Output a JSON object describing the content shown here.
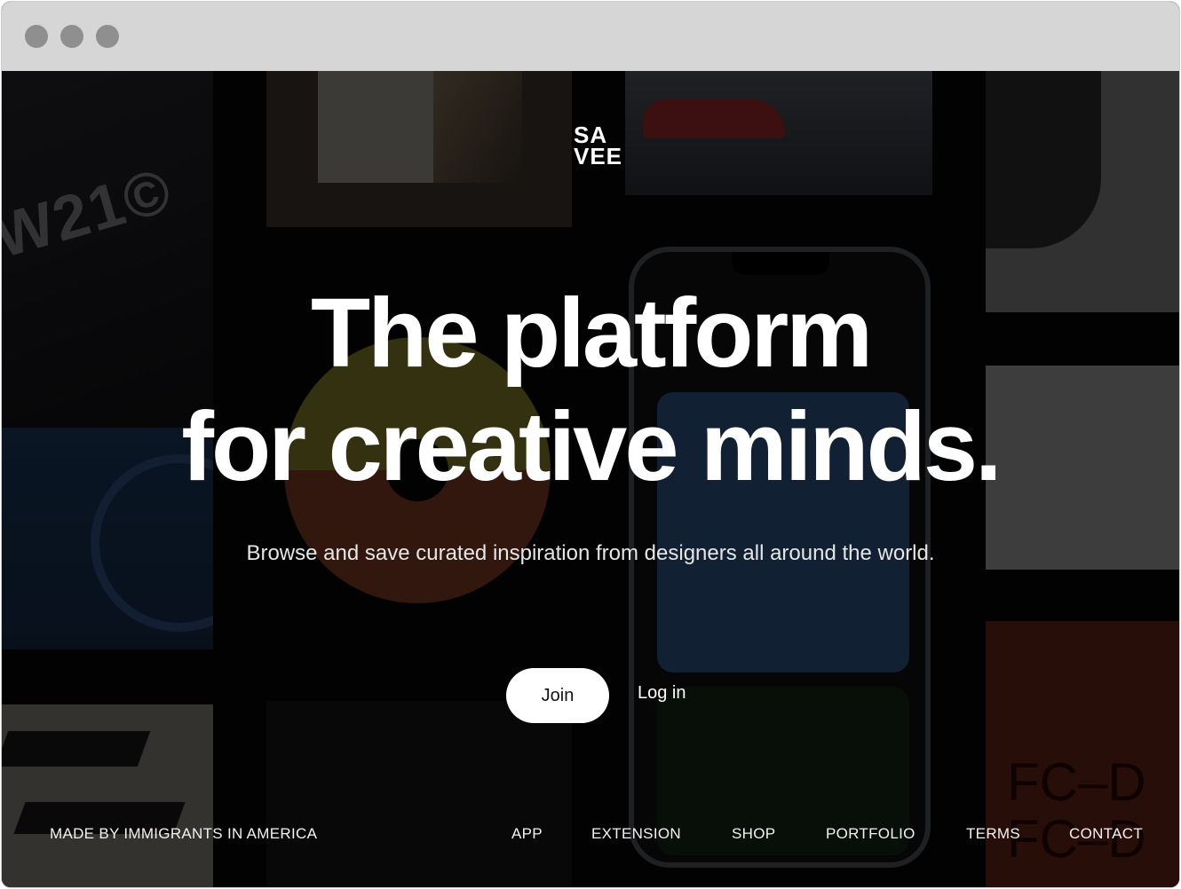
{
  "brand": {
    "logo_line1": "SA",
    "logo_line2": "VEE"
  },
  "hero": {
    "headline_line1": "The platform",
    "headline_line2": "for creative minds.",
    "subtitle": "Browse and save curated inspiration from designers all around the world."
  },
  "actions": {
    "join_label": "Join",
    "login_label": "Log in"
  },
  "footer": {
    "made_by": "MADE BY IMMIGRANTS IN AMERICA",
    "links": [
      "APP",
      "EXTENSION",
      "SHOP",
      "PORTFOLIO",
      "TERMS",
      "CONTACT"
    ]
  },
  "colors": {
    "background": "#000000",
    "text": "#ffffff",
    "button_bg": "#ffffff",
    "button_text": "#111111",
    "titlebar": "#d6d6d6"
  },
  "icons": [
    "window-close-dot",
    "window-minimize-dot",
    "window-zoom-dot"
  ]
}
